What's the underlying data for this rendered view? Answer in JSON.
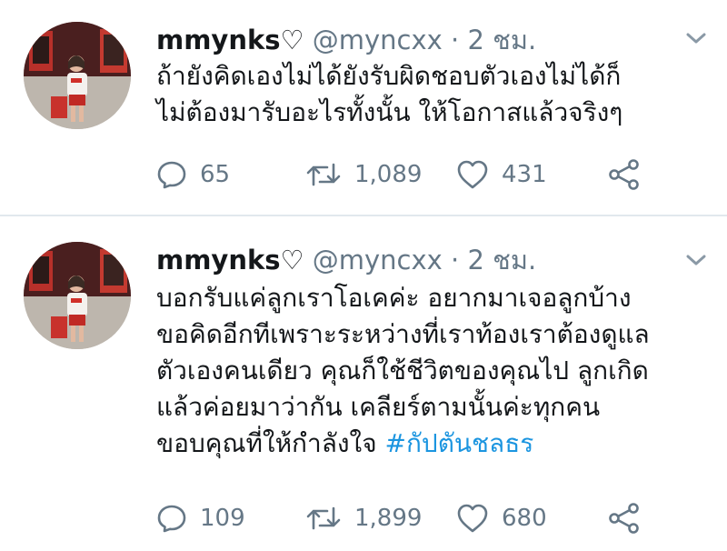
{
  "tweets": [
    {
      "display_name": "mmynks",
      "name_suffix": "♡",
      "handle": "@myncxx",
      "separator": "·",
      "time": "2 ชม.",
      "text_lines": [
        "ถ้ายังคิดเองไม่ได้ยังรับผิดชอบตัวเองไม่ได้ก็",
        "ไม่ต้องมารับอะไรทั้งนั้น ให้โอกาสแล้วจริงๆ"
      ],
      "hashtag": "",
      "replies": "65",
      "retweets": "1,089",
      "likes": "431"
    },
    {
      "display_name": "mmynks",
      "name_suffix": "♡",
      "handle": "@myncxx",
      "separator": "·",
      "time": "2 ชม.",
      "text_lines": [
        "บอกรับแค่ลูกเราโอเคค่ะ อยากมาเจอลูกบ้าง",
        "ขอคิดอีกทีเพราะระหว่างที่เราท้องเราต้องดูแล",
        "ตัวเองคนเดียว คุณก็ใช้ชีวิตของคุณไป ลูกเกิด",
        "แล้วค่อยมาว่ากัน เคลียร์ตามนั้นค่ะทุกคน",
        "ขอบคุณที่ให้กำลังใจ "
      ],
      "hashtag": "#กัปตันชลธร",
      "replies": "109",
      "retweets": "1,899",
      "likes": "680"
    }
  ],
  "icons": {
    "reply": "reply-icon",
    "retweet": "retweet-icon",
    "like": "heart-icon",
    "share": "share-icon",
    "more": "chevron-down-icon"
  },
  "colors": {
    "text": "#14171a",
    "secondary": "#657786",
    "link": "#1b95e0",
    "divider": "#e1e8ed"
  }
}
